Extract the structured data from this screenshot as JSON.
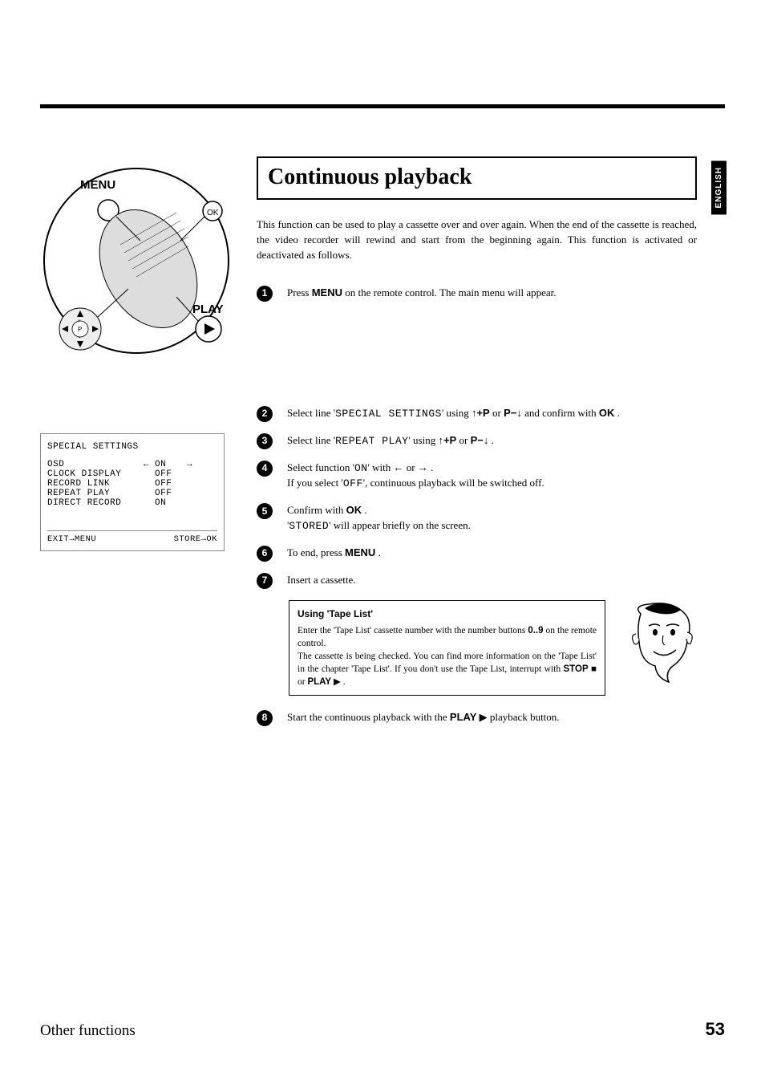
{
  "lang_tab": "ENGLISH",
  "title": "Continuous playback",
  "intro": "This function can be used to play a cassette over and over again. When the end of the cassette is reached, the video recorder will rewind and start from the beginning again. This function is activated or deactivated as follows.",
  "remote": {
    "menu_label": "MENU",
    "ok_label": "OK",
    "play_label": "PLAY"
  },
  "steps": {
    "s1_a": "Press ",
    "s1_menu": "MENU",
    "s1_b": " on the remote control. The main menu will appear.",
    "s2_a": "Select line '",
    "s2_mono": "SPECIAL SETTINGS",
    "s2_b": "' using ",
    "s2_up": "↑+P",
    "s2_or": " or ",
    "s2_down": "P−↓",
    "s2_c": " and confirm with ",
    "s2_ok": "OK",
    "s2_d": " .",
    "s3_a": "Select line '",
    "s3_mono": "REPEAT PLAY",
    "s3_b": "' using ",
    "s3_up": "↑+P",
    "s3_or": " or ",
    "s3_down": "P−↓",
    "s3_c": " .",
    "s4_a": "Select function '",
    "s4_on": "ON",
    "s4_b": "' with ",
    "s4_left": "←",
    "s4_or": " or ",
    "s4_right": "→",
    "s4_c": " .",
    "s4_d": "If you select '",
    "s4_off": "OFF",
    "s4_e": "', continuous playback will be switched off.",
    "s5_a": "Confirm with ",
    "s5_ok": "OK",
    "s5_b": " .",
    "s5_c": "'",
    "s5_stored": "STORED",
    "s5_d": "' will appear briefly on the screen.",
    "s6_a": "To end, press ",
    "s6_menu": "MENU",
    "s6_b": " .",
    "s7": "Insert a cassette.",
    "s8_a": "Start the continuous playback with the ",
    "s8_play": "PLAY",
    "s8_glyph": "▶",
    "s8_b": " playback button."
  },
  "osd": {
    "title": "SPECIAL SETTINGS",
    "rows": [
      {
        "label": "OSD",
        "arrow": "←",
        "val": "ON",
        "arrow2": "→"
      },
      {
        "label": "CLOCK DISPLAY",
        "arrow": "",
        "val": "OFF",
        "arrow2": ""
      },
      {
        "label": "RECORD LINK",
        "arrow": "",
        "val": "OFF",
        "arrow2": ""
      },
      {
        "label": "REPEAT PLAY",
        "arrow": "",
        "val": "OFF",
        "arrow2": ""
      },
      {
        "label": "DIRECT RECORD",
        "arrow": "",
        "val": "ON",
        "arrow2": ""
      }
    ],
    "footer_left": "EXIT→MENU",
    "footer_right": "STORE→OK"
  },
  "tip": {
    "title": "Using 'Tape List'",
    "line1_a": "Enter the 'Tape List' cassette number with the number buttons ",
    "line1_btn": "0..9",
    "line1_b": " on the remote control.",
    "line2_a": "The cassette is being checked. You can find more information on the 'Tape List' in the chapter 'Tape List'. If you don't use the Tape List, interrupt with ",
    "line2_stop": "STOP",
    "line2_stopglyph": "■",
    "line2_or": " or ",
    "line2_play": "PLAY",
    "line2_playglyph": "▶",
    "line2_b": " ."
  },
  "footer": {
    "section": "Other functions",
    "page": "53"
  }
}
